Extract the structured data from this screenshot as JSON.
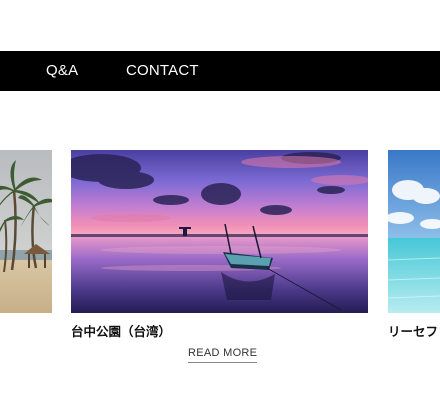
{
  "nav": {
    "items": [
      {
        "label": "Q&A"
      },
      {
        "label": "CONTACT"
      }
    ]
  },
  "carousel": {
    "slides": [
      {
        "image": "palm-beach-photo",
        "caption": ""
      },
      {
        "image": "sunset-boat-photo",
        "caption": "台中公園（台湾）"
      },
      {
        "image": "tropical-sea-photo",
        "caption": "リーセフ"
      }
    ],
    "read_more_label": "READ MORE"
  }
}
